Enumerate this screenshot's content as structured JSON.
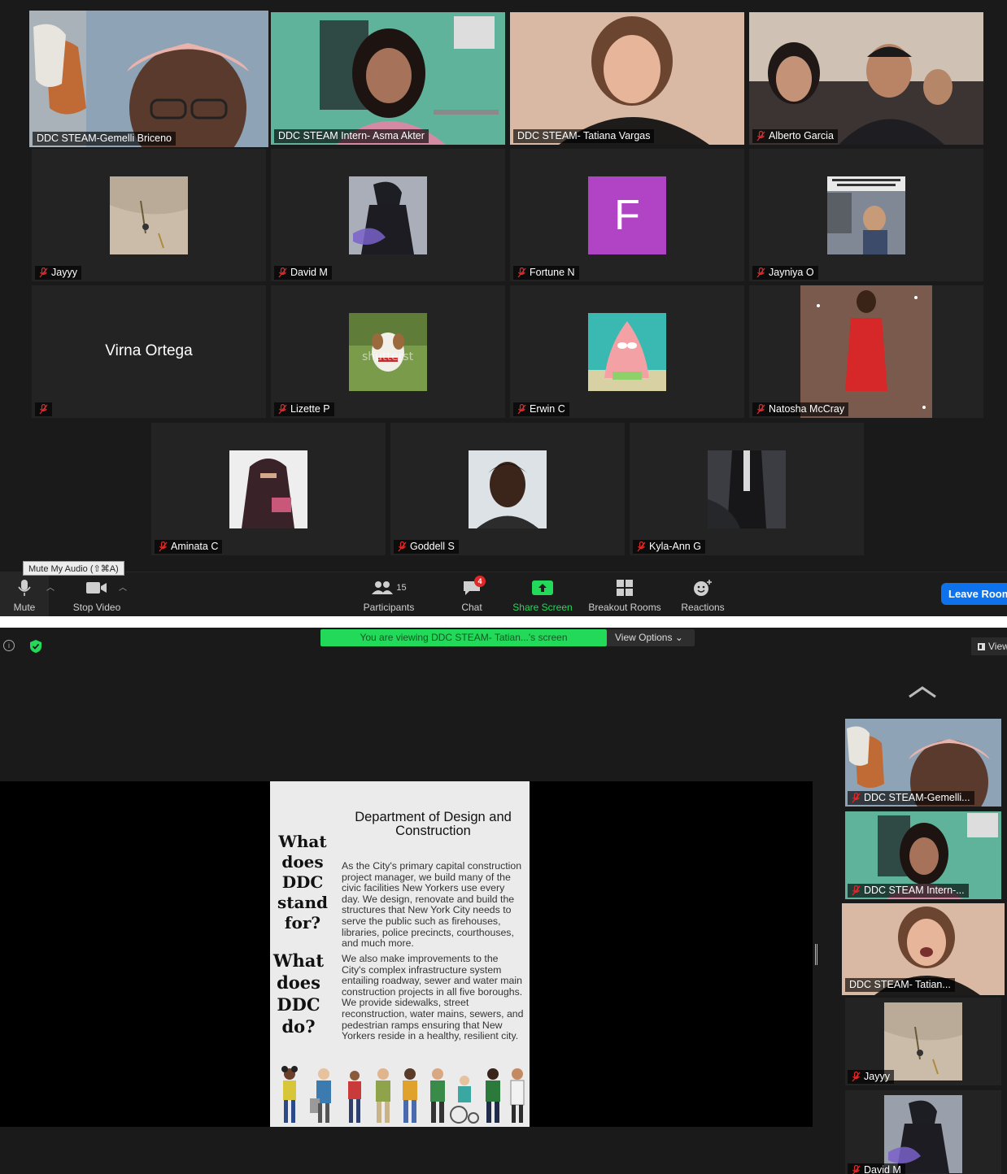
{
  "gallery": {
    "tiles": [
      {
        "name": "DDC STEAM-Gemelli Briceno",
        "muted": false
      },
      {
        "name": "DDC STEAM Intern- Asma Akter",
        "muted": false
      },
      {
        "name": "DDC STEAM- Tatiana Vargas",
        "muted": false
      },
      {
        "name": "Alberto Garcia",
        "muted": true
      },
      {
        "name": "Jayyy",
        "muted": true
      },
      {
        "name": "David M",
        "muted": true
      },
      {
        "name": "Fortune N",
        "muted": true,
        "avatar_letter": "F"
      },
      {
        "name": "Jayniya O",
        "muted": true
      },
      {
        "name": "Virna Ortega",
        "muted": true
      },
      {
        "name": "Lizette P",
        "muted": true
      },
      {
        "name": "Erwin C",
        "muted": true
      },
      {
        "name": "Natosha McCray",
        "muted": true
      },
      {
        "name": "Aminata C",
        "muted": true
      },
      {
        "name": "Goddell S",
        "muted": true
      },
      {
        "name": "Kyla-Ann G",
        "muted": true
      }
    ],
    "dog_watermark": "shutterst"
  },
  "toolbar": {
    "tooltip": "Mute My Audio (⇧⌘A)",
    "mute_label": "Mute",
    "stop_video_label": "Stop Video",
    "participants_label": "Participants",
    "participants_count": "15",
    "chat_label": "Chat",
    "chat_badge": "4",
    "share_screen_label": "Share Screen",
    "breakout_label": "Breakout Rooms",
    "reactions_label": "Reactions",
    "leave_label": "Leave Room"
  },
  "share": {
    "banner": "You are viewing DDC STEAM- Tatian...'s screen",
    "view_options": "View Options ⌄",
    "view_btn": "View",
    "slide": {
      "title": "Department of Design and Construction",
      "q1": "What does DDC stand for?",
      "q2": "What does DDC do?",
      "p1": "As the City's primary capital construction project manager, we build many of the civic facilities New Yorkers use every day.  We design, renovate and build the structures that New York City needs to serve the public such as firehouses, libraries, police precincts, courthouses, and much more.",
      "p2": "We also make improvements to the City's complex infrastructure system entailing roadway, sewer and water main construction projects in all five boroughs. We provide sidewalks, street reconstruction, water mains, sewers, and pedestrian ramps ensuring that New Yorkers reside in a healthy, resilient city."
    },
    "sidebar": [
      {
        "name": "DDC STEAM-Gemelli...",
        "muted": true
      },
      {
        "name": "DDC STEAM Intern-...",
        "muted": true
      },
      {
        "name": "DDC STEAM- Tatian...",
        "muted": false
      },
      {
        "name": "Jayyy",
        "muted": true
      },
      {
        "name": "David M",
        "muted": true
      }
    ]
  },
  "colors": {
    "active_border": "#cfe97a",
    "share_green": "#23d959",
    "leave_blue": "#0e72ed",
    "muted_red": "#e02828"
  }
}
